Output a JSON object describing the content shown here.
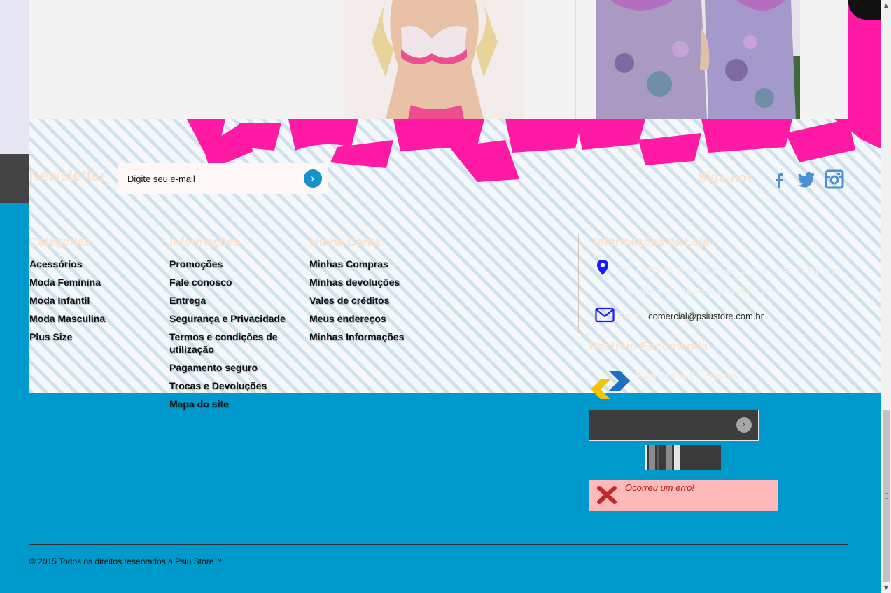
{
  "colors": {
    "footer_bg": "#0099cc",
    "heading": "#fbe3cf",
    "brand_pink": "#ff1aa6",
    "error_bg": "#ffb9b9",
    "error_text": "#b3141a"
  },
  "products": {
    "items": [
      {
        "image": "empty-product-image"
      },
      {
        "image": "lingerie-pink-bra-photo"
      },
      {
        "image": "floral-nightgown-photo"
      }
    ]
  },
  "newsletter": {
    "title": "Newsletter",
    "placeholder": "Digite seu e-mail",
    "submit_icon": "chevron-right-icon"
  },
  "social": {
    "title": "Siga-nos",
    "icons": [
      "facebook-icon",
      "twitter-icon",
      "instagram-icon"
    ]
  },
  "columns": {
    "categorias": {
      "title": "Categorias",
      "items": [
        "Acessórios",
        "Moda Feminina",
        "Moda Infantil",
        "Moda Masculina",
        "Plus Size"
      ]
    },
    "informacoes": {
      "title": "Informações",
      "items": [
        "Promoções",
        "Fale conosco",
        "Entrega",
        "Segurança e Privacidade",
        "Termos e condições de utilização",
        "Pagamento seguro",
        "Trocas e Devoluções",
        "Mapa do site"
      ]
    },
    "minha_conta": {
      "title": "Minha Conta",
      "items": [
        "Minhas Compras",
        "Minhas devoluções",
        "Vales de créditos",
        "Meus endereços",
        "Minhas Informações"
      ]
    }
  },
  "store_info": {
    "title": "Informações da Loja",
    "address": "PSIU STORE, Rua Rui Barbosa, 274 - CEP 11750-000 - Peruíbe - SP - BRASIL (13) 3455-1775",
    "email_label": "E-mail:",
    "email": "comercial@psiustore.com.br"
  },
  "tracking": {
    "title": "Rastreio Encomenda",
    "text": "Rastreie sua Encomenda",
    "submit_icon": "chevron-right-icon"
  },
  "error": {
    "message": "Ocorreu um erro!"
  },
  "footer": {
    "copyright": "© 2015 Todos os direitos reservados a Psiu Store™"
  }
}
